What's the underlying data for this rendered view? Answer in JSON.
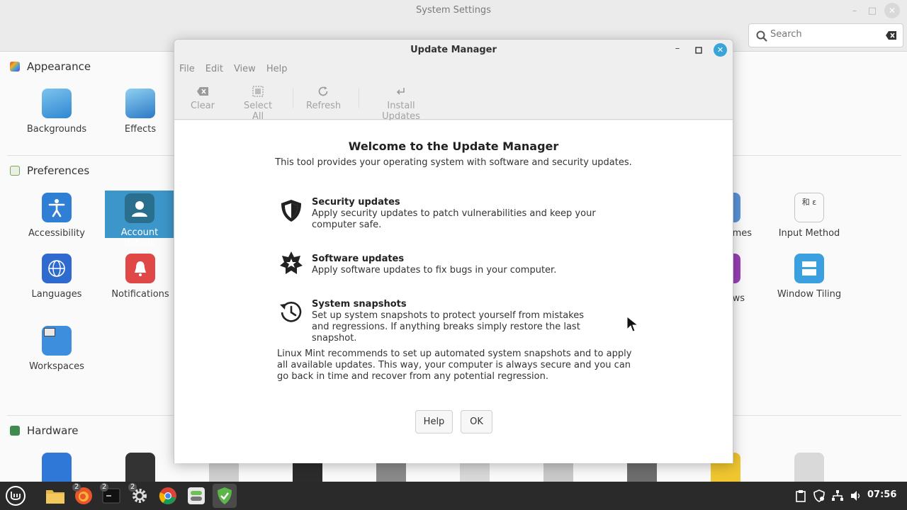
{
  "system_settings": {
    "title": "System Settings",
    "search": {
      "placeholder": "Search"
    },
    "categories": {
      "appearance": "Appearance",
      "preferences": "Preferences",
      "hardware": "Hardware"
    },
    "appearance_items": [
      "Backgrounds",
      "Effects"
    ],
    "preferences_items": {
      "accessibility": "Accessibility",
      "account_details": "Account details",
      "themes_partial": "mes",
      "input_method": "Input Method",
      "languages": "Languages",
      "notifications": "Notifications",
      "windows_partial": "ws",
      "window_tiling": "Window Tiling",
      "workspaces": "Workspaces"
    }
  },
  "update_manager": {
    "title": "Update Manager",
    "menu": [
      "File",
      "Edit",
      "View",
      "Help"
    ],
    "toolbar": {
      "clear": "Clear",
      "select_all": "Select All",
      "refresh": "Refresh",
      "install_updates": "Install Updates"
    },
    "welcome_title": "Welcome to the Update Manager",
    "welcome_subtitle": "This tool provides your operating system with software and security updates.",
    "features": [
      {
        "icon": "shield-icon",
        "title": "Security updates",
        "desc": "Apply security updates to patch vulnerabilities and keep your computer safe."
      },
      {
        "icon": "star-badge-icon",
        "title": "Software updates",
        "desc": "Apply software updates to fix bugs in your computer."
      },
      {
        "icon": "history-icon",
        "title": "System snapshots",
        "desc": "Set up system snapshots to protect yourself from mistakes and regressions. If anything breaks simply restore the last snapshot."
      }
    ],
    "recommendation": "Linux Mint recommends to set up automated system snapshots and to apply all available updates. This way, your computer is always secure and you can go back in time and recover from any potential regression.",
    "buttons": {
      "help": "Help",
      "ok": "OK"
    }
  },
  "taskbar": {
    "badges": {
      "firefox": "2",
      "terminal": "2",
      "settings": "2"
    },
    "clock": "07:56"
  },
  "colors": {
    "accent": "#39a4d8",
    "selected_tile": "#3d96c9",
    "taskbar": "#2a2a2a"
  }
}
